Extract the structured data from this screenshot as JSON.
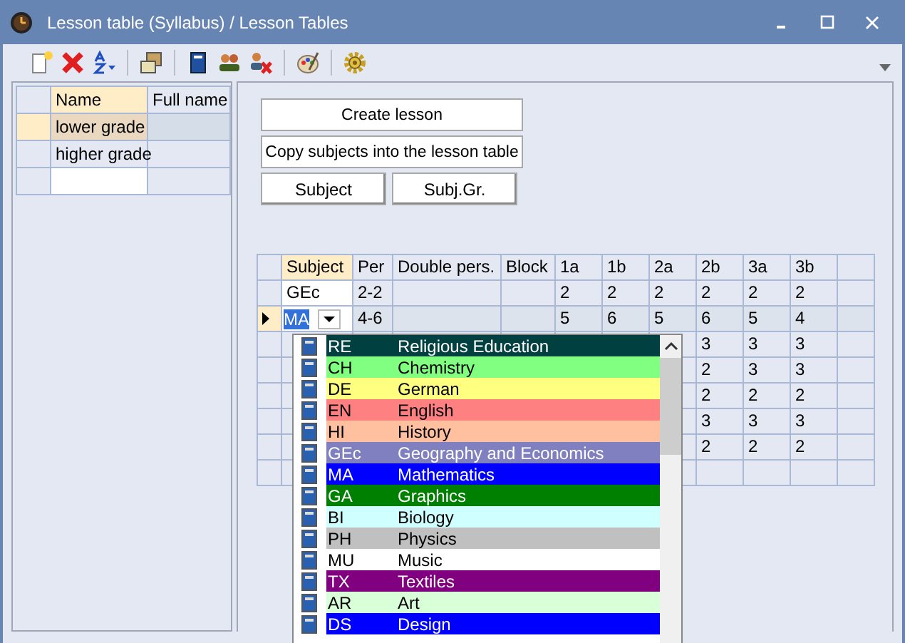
{
  "window": {
    "title": "Lesson table (Syllabus) / Lesson Tables"
  },
  "toolbar": {
    "tools": [
      {
        "kind": "new"
      },
      {
        "kind": "delete"
      },
      {
        "kind": "sort"
      },
      {
        "kind": "sep"
      },
      {
        "kind": "window"
      },
      {
        "kind": "sep"
      },
      {
        "kind": "book"
      },
      {
        "kind": "people"
      },
      {
        "kind": "people-delete"
      },
      {
        "kind": "sep"
      },
      {
        "kind": "palette"
      },
      {
        "kind": "sep"
      },
      {
        "kind": "gear"
      }
    ]
  },
  "tables_list": {
    "columns": [
      "Name",
      "Full name"
    ],
    "rows": [
      {
        "name": "lower grade",
        "selected": true
      },
      {
        "name": "higher grade",
        "selected": false
      }
    ]
  },
  "buttons": [
    "Create lesson",
    "Copy subjects into the lesson table"
  ],
  "small_buttons": [
    "Subject",
    "Subj.Gr."
  ],
  "lessons": {
    "columns": [
      "Subject",
      "Per",
      "Double pers.",
      "Block",
      "1a",
      "1b",
      "2a",
      "2b",
      "3a",
      "3b"
    ],
    "rows": [
      {
        "subject": "GEc",
        "per": "2-2",
        "periods": [
          "2",
          "2",
          "2",
          "2",
          "2",
          "2"
        ],
        "selected": false,
        "editing": false
      },
      {
        "subject": "MA",
        "per": "4-6",
        "periods": [
          "5",
          "6",
          "5",
          "6",
          "5",
          "4"
        ],
        "selected": true,
        "editing": true
      }
    ],
    "covered_rows": [
      {
        "periods_2b_to_3b": [
          "3",
          "3",
          "3"
        ]
      },
      {
        "periods_2b_to_3b": [
          "2",
          "3",
          "3"
        ]
      },
      {
        "periods_2b_to_3b": [
          "2",
          "2",
          "2"
        ]
      },
      {
        "periods_2b_to_3b": [
          "3",
          "3",
          "3"
        ]
      },
      {
        "periods_2b_to_3b": [
          "2",
          "2",
          "2"
        ]
      }
    ]
  },
  "subject_dropdown": {
    "items": [
      {
        "code": "RE",
        "name": "Religious Education",
        "color": "#004040"
      },
      {
        "code": "CH",
        "name": "Chemistry",
        "color": "#80ff80"
      },
      {
        "code": "DE",
        "name": "German",
        "color": "#ffff80"
      },
      {
        "code": "EN",
        "name": "English",
        "color": "#ff8080"
      },
      {
        "code": "HI",
        "name": "History",
        "color": "#ffc0a0"
      },
      {
        "code": "GEc",
        "name": "Geography and Economics",
        "color": "#8080c0"
      },
      {
        "code": "MA",
        "name": "Mathematics",
        "color": "#0000ff"
      },
      {
        "code": "GA",
        "name": "Graphics",
        "color": "#008000"
      },
      {
        "code": "BI",
        "name": "Biology",
        "color": "#d0ffff"
      },
      {
        "code": "PH",
        "name": "Physics",
        "color": "#c0c0c0"
      },
      {
        "code": "MU",
        "name": "Music",
        "color": "#ffffff"
      },
      {
        "code": "TX",
        "name": "Textiles",
        "color": "#800080"
      },
      {
        "code": "AR",
        "name": "Art",
        "color": "#d8ffd8"
      },
      {
        "code": "DS",
        "name": "Design",
        "color": "#0000ff"
      }
    ]
  }
}
